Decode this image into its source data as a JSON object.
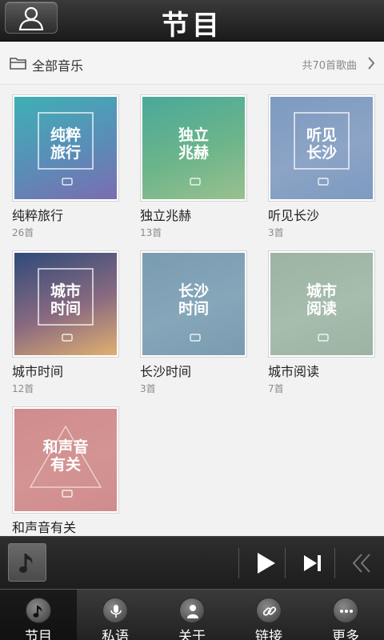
{
  "header": {
    "title": "节目"
  },
  "summary": {
    "label": "全部音乐",
    "count": "共70首歌曲"
  },
  "albums": [
    {
      "title": "纯粹旅行",
      "count": "26首",
      "cover_text": "纯粹旅行",
      "colors": [
        "#3fb0b4",
        "#5a8db8",
        "#7a6db0"
      ]
    },
    {
      "title": "独立兆赫",
      "count": "13首",
      "cover_text": "独立兆赫",
      "colors": [
        "#4aa89a",
        "#6cb58a",
        "#9ac090"
      ]
    },
    {
      "title": "听见长沙",
      "count": "3首",
      "cover_text": "听见长沙",
      "colors": [
        "#7d9ac0",
        "#8ca4c6",
        "#7d9ac0"
      ]
    },
    {
      "title": "城市时间",
      "count": "12首",
      "cover_text": "城市时间",
      "colors": [
        "#2e4a7a",
        "#8a6a80",
        "#e0b070"
      ]
    },
    {
      "title": "长沙时间",
      "count": "3首",
      "cover_text": "长沙时间",
      "colors": [
        "#7a9cb0",
        "#86a6ba",
        "#7a9cb0"
      ]
    },
    {
      "title": "城市阅读",
      "count": "7首",
      "cover_text": "城市阅读",
      "colors": [
        "#9cb4a4",
        "#a6bcac",
        "#9cb4a4"
      ]
    },
    {
      "title": "和声音有关",
      "count": "",
      "cover_text": "和声音有关",
      "colors": [
        "#d08c8c",
        "#d49494",
        "#d08c8c"
      ]
    }
  ],
  "player": {
    "now_playing_icon": "music-note-icon",
    "play_icon": "play-icon",
    "next_icon": "next-track-icon",
    "collapse_icon": "double-chevron-left-icon"
  },
  "tabs": [
    {
      "label": "节目",
      "icon": "music-note-icon",
      "active": true
    },
    {
      "label": "私语",
      "icon": "microphone-icon",
      "active": false
    },
    {
      "label": "关于",
      "icon": "person-icon",
      "active": false
    },
    {
      "label": "链接",
      "icon": "link-icon",
      "active": false
    },
    {
      "label": "更多",
      "icon": "more-icon",
      "active": false
    }
  ]
}
